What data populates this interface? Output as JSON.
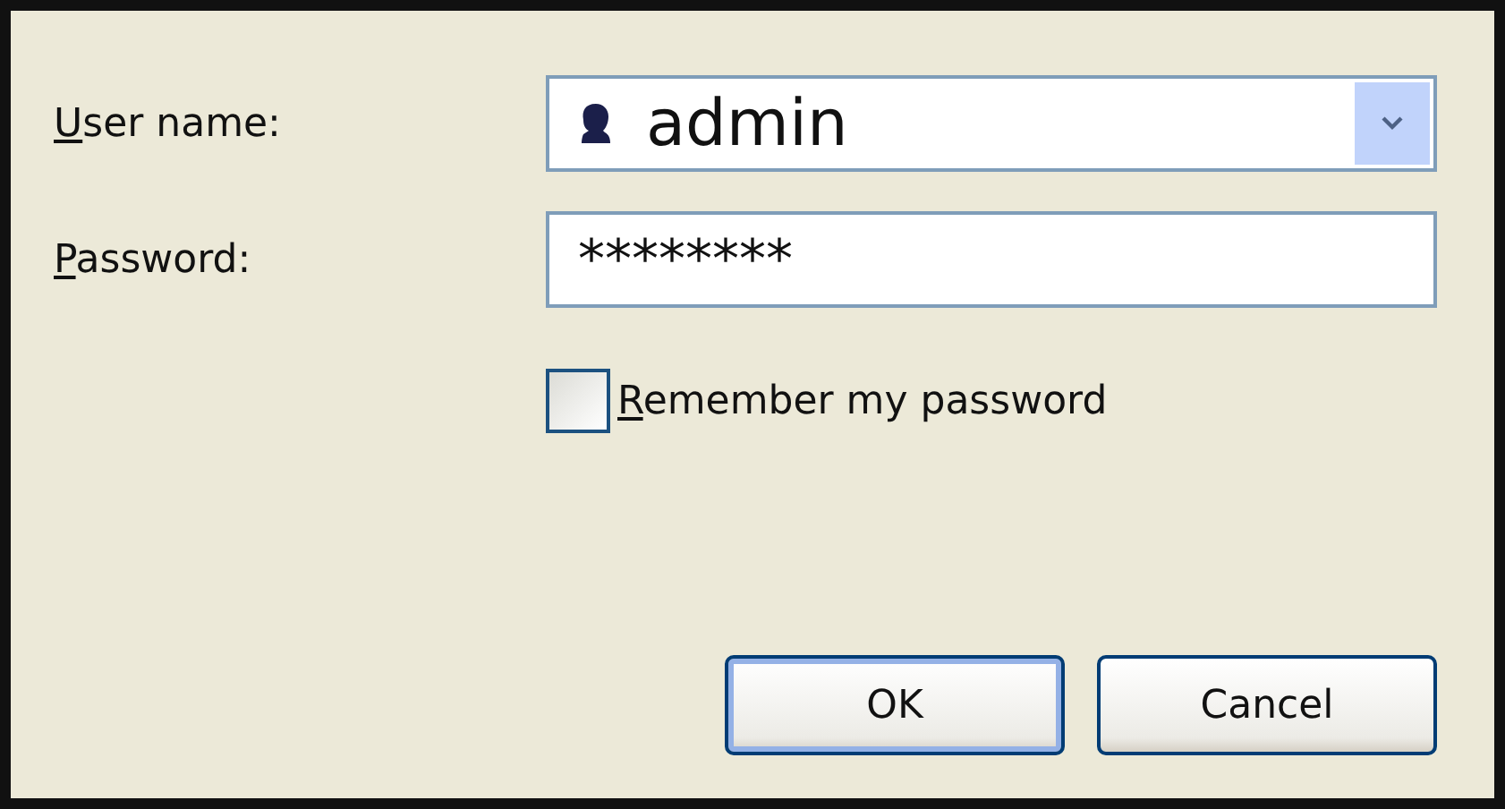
{
  "fields": [
    {
      "kind": "combo",
      "label": {
        "mnemonic": "U",
        "rest": "ser name:"
      },
      "value": "admin"
    },
    {
      "kind": "password",
      "label": {
        "mnemonic": "P",
        "rest": "assword:"
      },
      "value": "********"
    }
  ],
  "remember": {
    "label": {
      "mnemonic": "R",
      "rest": "emember my password"
    },
    "checked": false
  },
  "buttons": [
    {
      "label": "OK",
      "default": true
    },
    {
      "label": "Cancel",
      "default": false
    }
  ]
}
